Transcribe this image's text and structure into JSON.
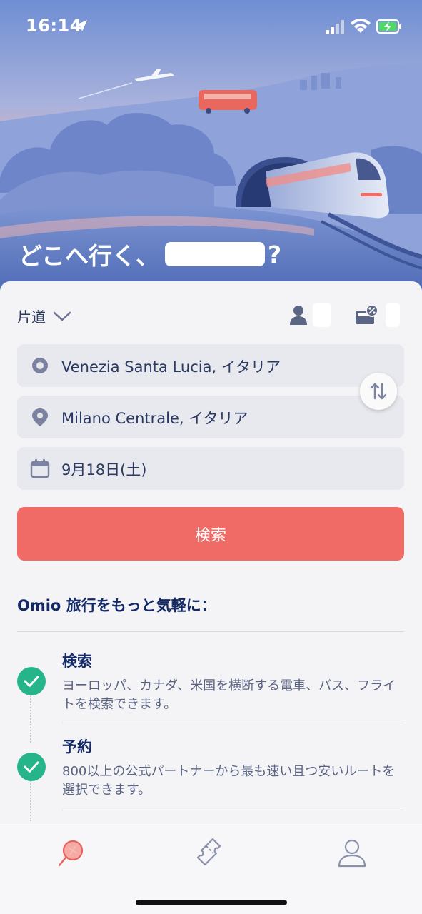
{
  "status_bar": {
    "time": "16:14"
  },
  "hero": {
    "title_prefix": "どこへ行く、",
    "title_suffix": "?"
  },
  "trip": {
    "type_label": "片道"
  },
  "fields": {
    "origin": "Venezia Santa Lucia, イタリア",
    "destination": "Milano Centrale, イタリア",
    "date": "9月18日(土)"
  },
  "search_button": "検索",
  "benefits": {
    "title": "Omio 旅行をもっと気軽に：",
    "items": [
      {
        "title": "検索",
        "description": "ヨーロッパ、カナダ、米国を横断する電車、バス、フライトを検索できます。"
      },
      {
        "title": "予約",
        "description": "800以上の公式パートナーから最も速い且つ安いルートを選択できます。"
      }
    ]
  },
  "colors": {
    "accent": "#f06a66",
    "check_green": "#26b58a",
    "navy_text": "#132968",
    "field_bg": "#e8e9ee"
  },
  "icons": {
    "tab_search": "search-icon",
    "tab_tickets": "ticket-icon",
    "tab_account": "user-icon"
  },
  "tabbar": {
    "active": "search"
  }
}
